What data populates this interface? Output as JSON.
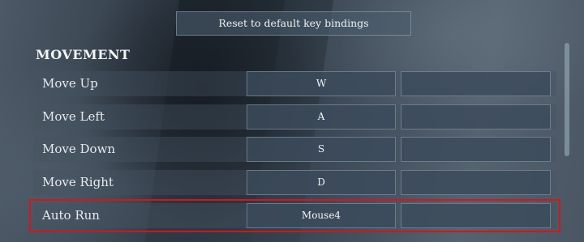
{
  "toolbar": {
    "reset_label": "Reset to default key bindings"
  },
  "section": {
    "title": "MOVEMENT"
  },
  "bindings": [
    {
      "label": "Move Up",
      "primary": "W",
      "secondary": ""
    },
    {
      "label": "Move Left",
      "primary": "A",
      "secondary": ""
    },
    {
      "label": "Move Down",
      "primary": "S",
      "secondary": ""
    },
    {
      "label": "Move Right",
      "primary": "D",
      "secondary": ""
    },
    {
      "label": "Auto Run",
      "primary": "Mouse4",
      "secondary": "",
      "highlighted": true
    }
  ],
  "colors": {
    "highlight_outline": "#d0171c",
    "text": "#e8ecef"
  }
}
